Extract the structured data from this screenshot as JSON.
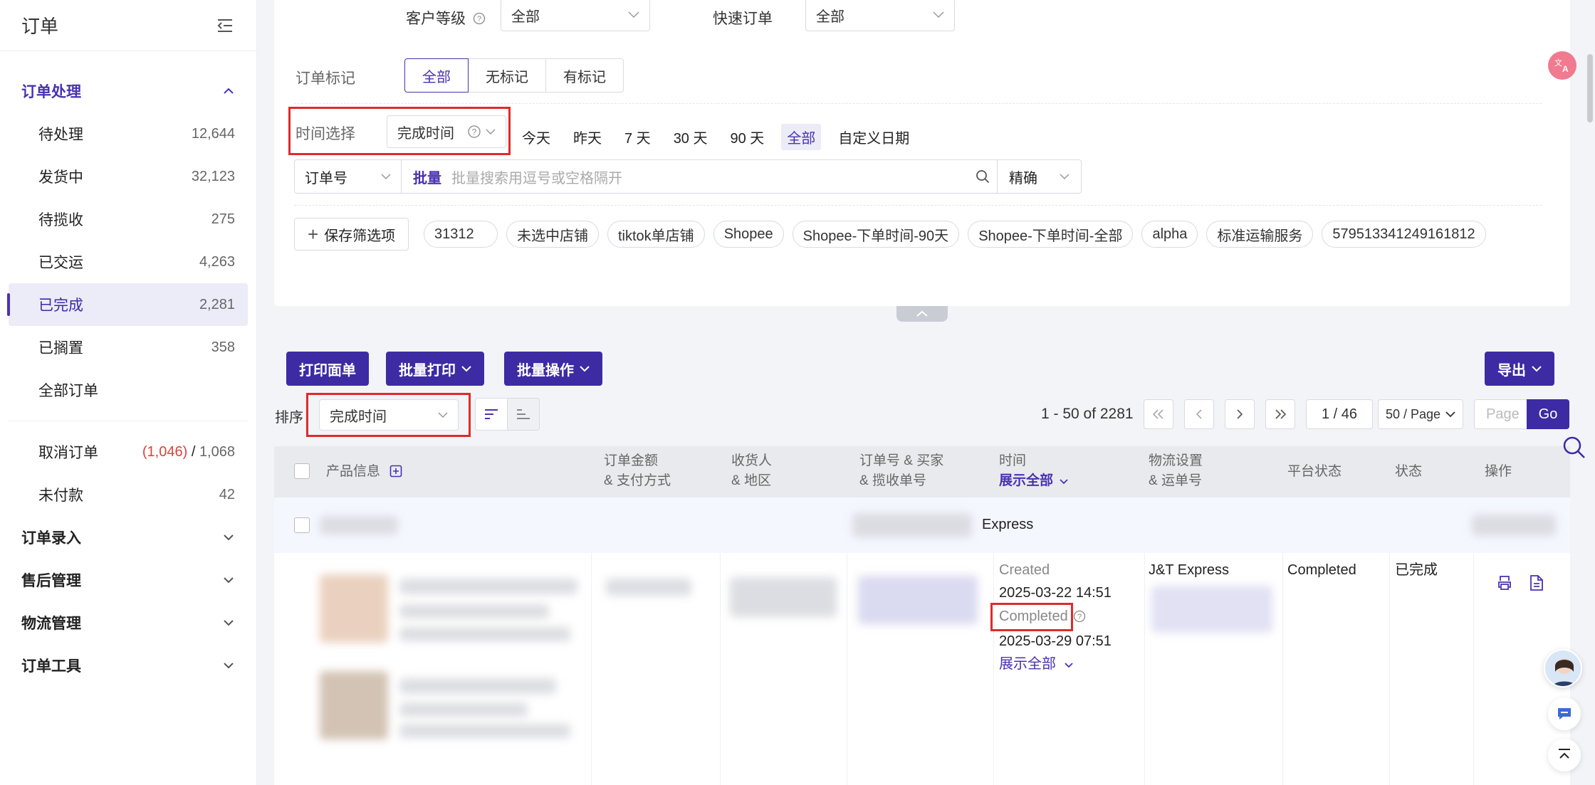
{
  "sidebar": {
    "title": "订单",
    "groups": [
      {
        "label": "订单处理"
      },
      {
        "label": "订单录入"
      },
      {
        "label": "售后管理"
      },
      {
        "label": "物流管理"
      },
      {
        "label": "订单工具"
      }
    ],
    "items": [
      {
        "label": "待处理",
        "count": "12,644"
      },
      {
        "label": "发货中",
        "count": "32,123"
      },
      {
        "label": "待揽收",
        "count": "275"
      },
      {
        "label": "已交运",
        "count": "4,263"
      },
      {
        "label": "已完成",
        "count": "2,281",
        "active": true
      },
      {
        "label": "已搁置",
        "count": "358"
      },
      {
        "label": "全部订单",
        "count": ""
      }
    ],
    "cancel": {
      "label": "取消订单",
      "count_red": "(1,046)",
      "sep": "/",
      "count": "1,068"
    },
    "unpaid": {
      "label": "未付款",
      "count": "42"
    }
  },
  "filters": {
    "customer_level_label": "客户等级",
    "customer_level_value": "全部",
    "quick_order_label": "快速订单",
    "quick_order_value": "全部",
    "order_mark_label": "订单标记",
    "order_mark_options": [
      "全部",
      "无标记",
      "有标记"
    ],
    "time_label": "时间选择",
    "time_type": "完成时间",
    "time_quick": [
      "今天",
      "昨天",
      "7 天",
      "30 天",
      "90 天",
      "全部",
      "自定义日期"
    ],
    "search_field": "订单号",
    "search_batch": "批量",
    "search_placeholder": "批量搜索用逗号或空格隔开",
    "search_mode": "精确",
    "save_button": "保存筛选项",
    "saved_chips": [
      "31312",
      "未选中店铺",
      "tiktok单店铺",
      "Shopee",
      "Shopee-下单时间-90天",
      "Shopee-下单时间-全部",
      "alpha",
      "标准运输服务",
      "579513341249161812"
    ]
  },
  "toolbar": {
    "print_label": "打印面单",
    "batch_print_label": "批量打印",
    "batch_ops_label": "批量操作",
    "export_label": "导出",
    "sort_label": "排序",
    "sort_value": "完成时间"
  },
  "pagination": {
    "range": "1 - 50 of 2281",
    "page": "1 / 46",
    "page_size": "50 / Page",
    "goto_placeholder": "Page",
    "go_label": "Go"
  },
  "table": {
    "headers": {
      "product": "产品信息",
      "amount_1": "订单金额",
      "amount_2": "& 支付方式",
      "receiver_1": "收货人",
      "receiver_2": "& 地区",
      "order_1": "订单号 & 买家",
      "order_2": "& 揽收单号",
      "time_1": "时间",
      "time_2": "展示全部",
      "logistics_1": "物流设置",
      "logistics_2": "& 运单号",
      "platform_status": "平台状态",
      "status": "状态",
      "actions": "操作"
    },
    "row": {
      "header_text": "Express",
      "created_label": "Created",
      "created_time": "2025-03-22 14:51",
      "completed_label": "Completed",
      "completed_time": "2025-03-29 07:51",
      "show_all": "展示全部",
      "carrier": "J&T Express",
      "platform_status": "Completed",
      "status": "已完成"
    }
  },
  "colors": {
    "accent": "#3d2ba3",
    "highlight_box": "#e02a2a"
  }
}
